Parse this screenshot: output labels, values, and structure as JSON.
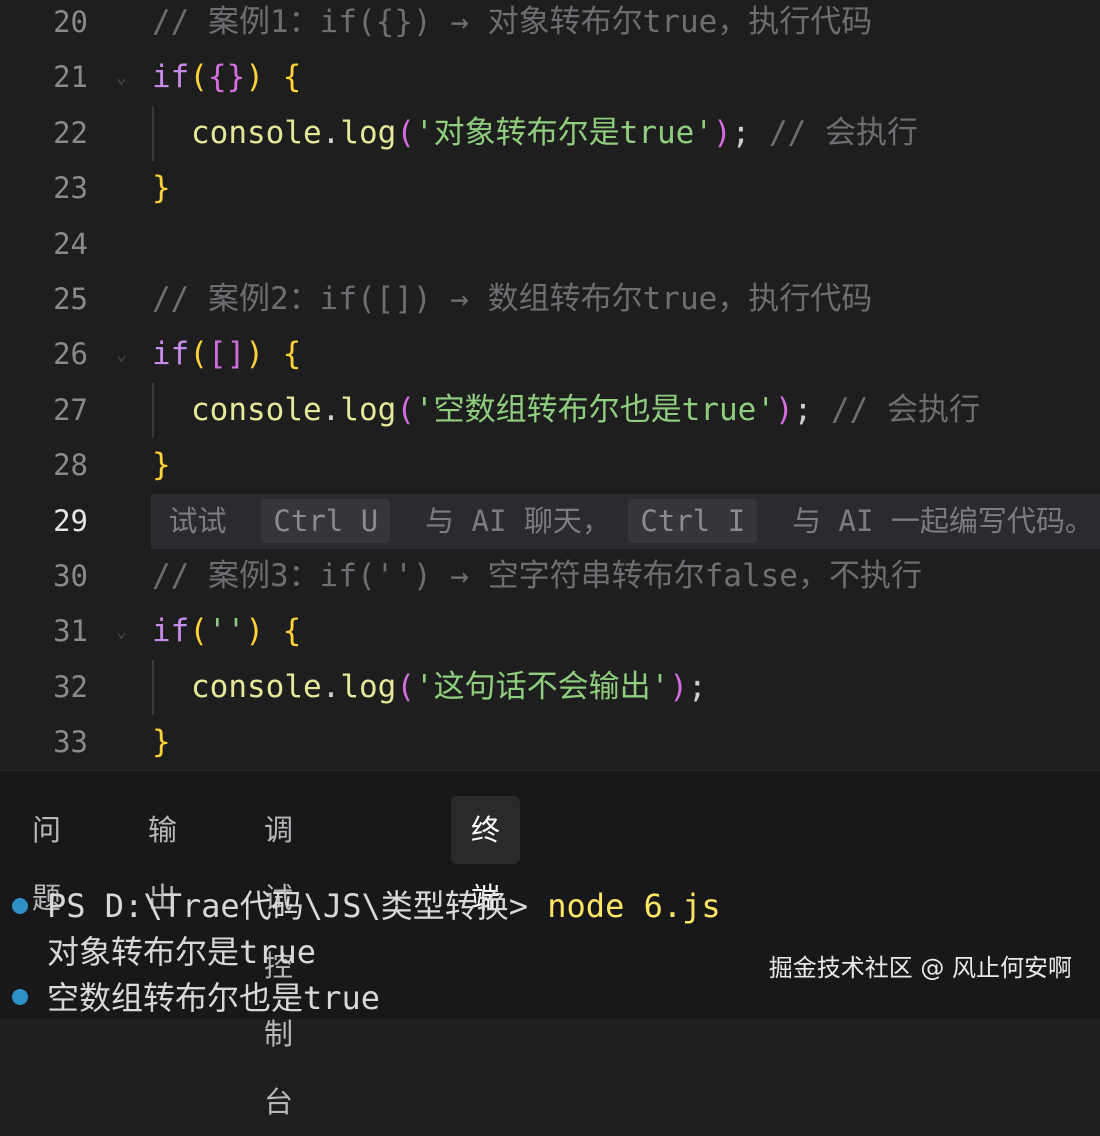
{
  "editor": {
    "lines": [
      {
        "n": "20"
      },
      {
        "n": "21"
      },
      {
        "n": "22"
      },
      {
        "n": "23"
      },
      {
        "n": "24"
      },
      {
        "n": "25"
      },
      {
        "n": "26"
      },
      {
        "n": "27"
      },
      {
        "n": "28"
      },
      {
        "n": "29"
      },
      {
        "n": "30"
      },
      {
        "n": "31"
      },
      {
        "n": "32"
      },
      {
        "n": "33"
      }
    ],
    "code": {
      "l20": "// 案例1：if({}) → 对象转布尔true，执行代码",
      "l21_kw": "if",
      "l21_open": "(",
      "l21_brace": "{}",
      "l21_close": ")",
      "l21_end": " {",
      "l22_fn": "console",
      "l22_dot": ".",
      "l22_log": "log",
      "l22_open": "(",
      "l22_str": "'对象转布尔是true'",
      "l22_close": ")",
      "l22_semi": ";",
      "l22_comment": " // 会执行",
      "l23": "}",
      "l25": "// 案例2：if([]) → 数组转布尔true，执行代码",
      "l26_kw": "if",
      "l26_open": "(",
      "l26_br": "[]",
      "l26_close": ")",
      "l26_end": " {",
      "l27_fn": "console",
      "l27_dot": ".",
      "l27_log": "log",
      "l27_open": "(",
      "l27_str": "'空数组转布尔也是true'",
      "l27_close": ")",
      "l27_semi": ";",
      "l27_comment": " // 会执行",
      "l28": "}",
      "l30": "// 案例3：if('') → 空字符串转布尔false，不执行",
      "l31_kw": "if",
      "l31_open": "(",
      "l31_str": "''",
      "l31_close": ")",
      "l31_end": " {",
      "l32_fn": "console",
      "l32_dot": ".",
      "l32_log": "log",
      "l32_open": "(",
      "l32_str": "'这句话不会输出'",
      "l32_close": ")",
      "l32_semi": ";",
      "l33": "}"
    },
    "ghost_hint": {
      "try": "试试",
      "kbd1": "Ctrl U",
      "mid": "与 AI 聊天，",
      "kbd2": "Ctrl I",
      "end": "与 AI 一起编写代码。"
    }
  },
  "panel": {
    "tabs": [
      "问题",
      "输出",
      "调试控制台",
      "终端"
    ],
    "active_tab": "终端"
  },
  "terminal": {
    "prompt": "PS D:\\Trae代码\\JS\\类型转换> ",
    "command": "node 6.js",
    "output1": "对象转布尔是true",
    "output2": "空数组转布尔也是true"
  },
  "watermark": "掘金技术社区 @ 风止何安啊",
  "colors": {
    "background": "#1e1e1f",
    "keyword": "#c88ce8",
    "string": "#8fce7e",
    "function": "#e7e79a",
    "comment": "#6e6e72",
    "bracket_level1": "#ffd23a",
    "bracket_level2": "#d46ee0",
    "terminal_dot": "#2e90c4"
  }
}
